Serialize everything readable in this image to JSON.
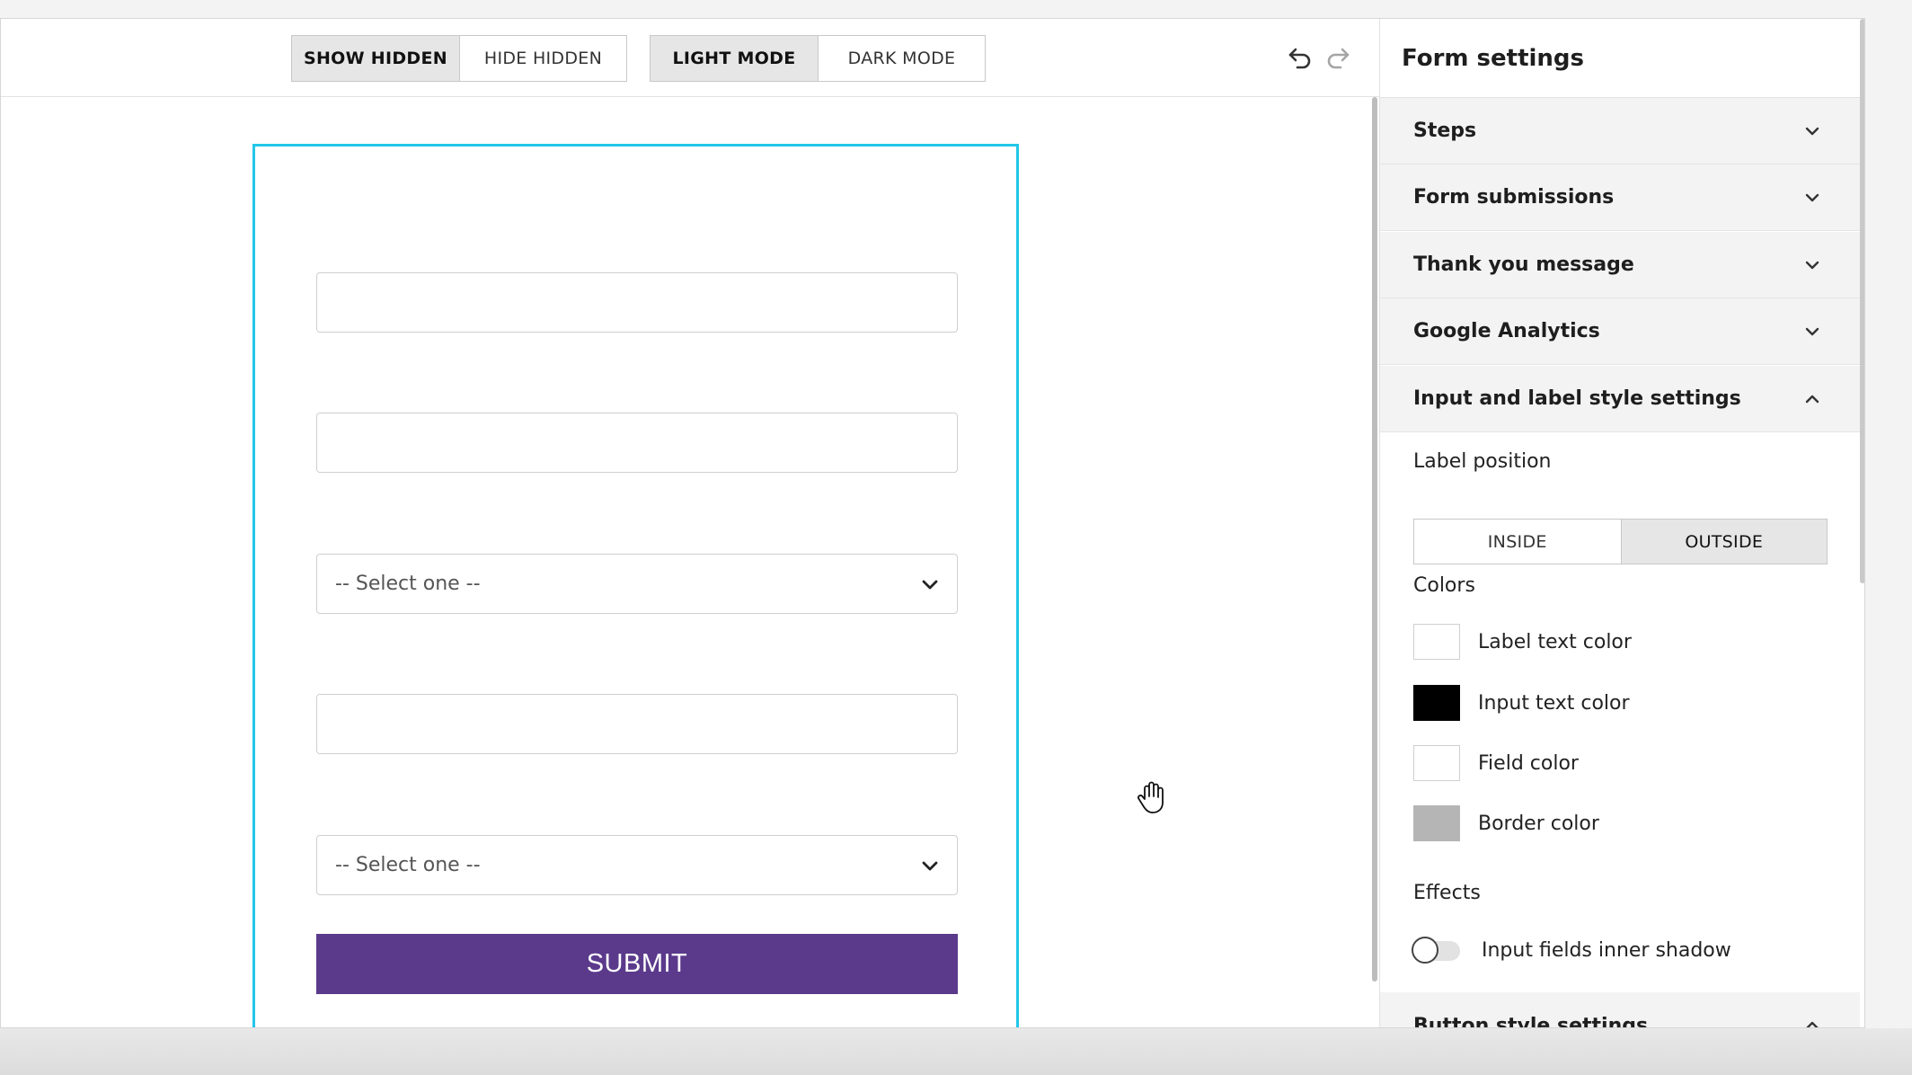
{
  "toolbar": {
    "visibility": {
      "show_label": "SHOW HIDDEN",
      "hide_label": "HIDE HIDDEN",
      "active": "show"
    },
    "mode": {
      "light_label": "LIGHT MODE",
      "dark_label": "DARK MODE",
      "active": "light"
    },
    "undo_icon": "undo-icon",
    "redo_icon": "redo-icon"
  },
  "form": {
    "select_placeholder_1": "-- Select one --",
    "select_placeholder_2": "-- Select one --",
    "submit_label": "SUBMIT",
    "submit_color": "#5b3a8c",
    "selected_outline_color": "#22c7e8"
  },
  "panel": {
    "title": "Form settings",
    "sections": {
      "steps": "Steps",
      "form_submissions": "Form submissions",
      "thank_you": "Thank you message",
      "google_analytics": "Google Analytics",
      "input_label_style": "Input and label style settings",
      "button_style": "Button style settings"
    },
    "label_position": {
      "heading": "Label position",
      "inside_label": "INSIDE",
      "outside_label": "OUTSIDE",
      "active": "outside"
    },
    "colors": {
      "heading": "Colors",
      "label_text": {
        "label": "Label text color",
        "value": "#ffffff"
      },
      "input_text": {
        "label": "Input text color",
        "value": "#000000"
      },
      "field": {
        "label": "Field color",
        "value": "#ffffff"
      },
      "border": {
        "label": "Border color",
        "value": "#b5b5b5"
      }
    },
    "effects": {
      "heading": "Effects",
      "inner_shadow": {
        "label": "Input fields inner shadow",
        "enabled": false
      }
    }
  }
}
